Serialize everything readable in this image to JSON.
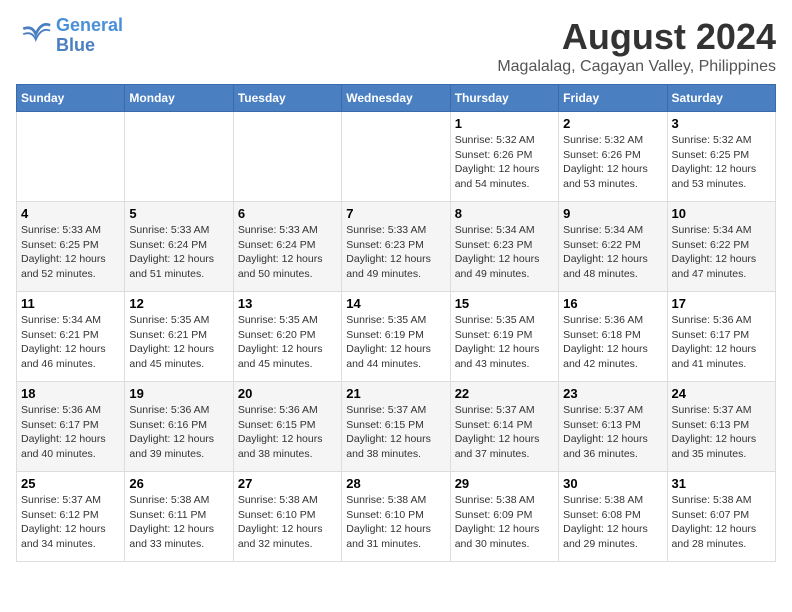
{
  "header": {
    "logo_line1": "General",
    "logo_line2": "Blue",
    "month_title": "August 2024",
    "location": "Magalalag, Cagayan Valley, Philippines"
  },
  "days_of_week": [
    "Sunday",
    "Monday",
    "Tuesday",
    "Wednesday",
    "Thursday",
    "Friday",
    "Saturday"
  ],
  "weeks": [
    [
      {
        "day": "",
        "info": ""
      },
      {
        "day": "",
        "info": ""
      },
      {
        "day": "",
        "info": ""
      },
      {
        "day": "",
        "info": ""
      },
      {
        "day": "1",
        "info": "Sunrise: 5:32 AM\nSunset: 6:26 PM\nDaylight: 12 hours\nand 54 minutes."
      },
      {
        "day": "2",
        "info": "Sunrise: 5:32 AM\nSunset: 6:26 PM\nDaylight: 12 hours\nand 53 minutes."
      },
      {
        "day": "3",
        "info": "Sunrise: 5:32 AM\nSunset: 6:25 PM\nDaylight: 12 hours\nand 53 minutes."
      }
    ],
    [
      {
        "day": "4",
        "info": "Sunrise: 5:33 AM\nSunset: 6:25 PM\nDaylight: 12 hours\nand 52 minutes."
      },
      {
        "day": "5",
        "info": "Sunrise: 5:33 AM\nSunset: 6:24 PM\nDaylight: 12 hours\nand 51 minutes."
      },
      {
        "day": "6",
        "info": "Sunrise: 5:33 AM\nSunset: 6:24 PM\nDaylight: 12 hours\nand 50 minutes."
      },
      {
        "day": "7",
        "info": "Sunrise: 5:33 AM\nSunset: 6:23 PM\nDaylight: 12 hours\nand 49 minutes."
      },
      {
        "day": "8",
        "info": "Sunrise: 5:34 AM\nSunset: 6:23 PM\nDaylight: 12 hours\nand 49 minutes."
      },
      {
        "day": "9",
        "info": "Sunrise: 5:34 AM\nSunset: 6:22 PM\nDaylight: 12 hours\nand 48 minutes."
      },
      {
        "day": "10",
        "info": "Sunrise: 5:34 AM\nSunset: 6:22 PM\nDaylight: 12 hours\nand 47 minutes."
      }
    ],
    [
      {
        "day": "11",
        "info": "Sunrise: 5:34 AM\nSunset: 6:21 PM\nDaylight: 12 hours\nand 46 minutes."
      },
      {
        "day": "12",
        "info": "Sunrise: 5:35 AM\nSunset: 6:21 PM\nDaylight: 12 hours\nand 45 minutes."
      },
      {
        "day": "13",
        "info": "Sunrise: 5:35 AM\nSunset: 6:20 PM\nDaylight: 12 hours\nand 45 minutes."
      },
      {
        "day": "14",
        "info": "Sunrise: 5:35 AM\nSunset: 6:19 PM\nDaylight: 12 hours\nand 44 minutes."
      },
      {
        "day": "15",
        "info": "Sunrise: 5:35 AM\nSunset: 6:19 PM\nDaylight: 12 hours\nand 43 minutes."
      },
      {
        "day": "16",
        "info": "Sunrise: 5:36 AM\nSunset: 6:18 PM\nDaylight: 12 hours\nand 42 minutes."
      },
      {
        "day": "17",
        "info": "Sunrise: 5:36 AM\nSunset: 6:17 PM\nDaylight: 12 hours\nand 41 minutes."
      }
    ],
    [
      {
        "day": "18",
        "info": "Sunrise: 5:36 AM\nSunset: 6:17 PM\nDaylight: 12 hours\nand 40 minutes."
      },
      {
        "day": "19",
        "info": "Sunrise: 5:36 AM\nSunset: 6:16 PM\nDaylight: 12 hours\nand 39 minutes."
      },
      {
        "day": "20",
        "info": "Sunrise: 5:36 AM\nSunset: 6:15 PM\nDaylight: 12 hours\nand 38 minutes."
      },
      {
        "day": "21",
        "info": "Sunrise: 5:37 AM\nSunset: 6:15 PM\nDaylight: 12 hours\nand 38 minutes."
      },
      {
        "day": "22",
        "info": "Sunrise: 5:37 AM\nSunset: 6:14 PM\nDaylight: 12 hours\nand 37 minutes."
      },
      {
        "day": "23",
        "info": "Sunrise: 5:37 AM\nSunset: 6:13 PM\nDaylight: 12 hours\nand 36 minutes."
      },
      {
        "day": "24",
        "info": "Sunrise: 5:37 AM\nSunset: 6:13 PM\nDaylight: 12 hours\nand 35 minutes."
      }
    ],
    [
      {
        "day": "25",
        "info": "Sunrise: 5:37 AM\nSunset: 6:12 PM\nDaylight: 12 hours\nand 34 minutes."
      },
      {
        "day": "26",
        "info": "Sunrise: 5:38 AM\nSunset: 6:11 PM\nDaylight: 12 hours\nand 33 minutes."
      },
      {
        "day": "27",
        "info": "Sunrise: 5:38 AM\nSunset: 6:10 PM\nDaylight: 12 hours\nand 32 minutes."
      },
      {
        "day": "28",
        "info": "Sunrise: 5:38 AM\nSunset: 6:10 PM\nDaylight: 12 hours\nand 31 minutes."
      },
      {
        "day": "29",
        "info": "Sunrise: 5:38 AM\nSunset: 6:09 PM\nDaylight: 12 hours\nand 30 minutes."
      },
      {
        "day": "30",
        "info": "Sunrise: 5:38 AM\nSunset: 6:08 PM\nDaylight: 12 hours\nand 29 minutes."
      },
      {
        "day": "31",
        "info": "Sunrise: 5:38 AM\nSunset: 6:07 PM\nDaylight: 12 hours\nand 28 minutes."
      }
    ]
  ]
}
